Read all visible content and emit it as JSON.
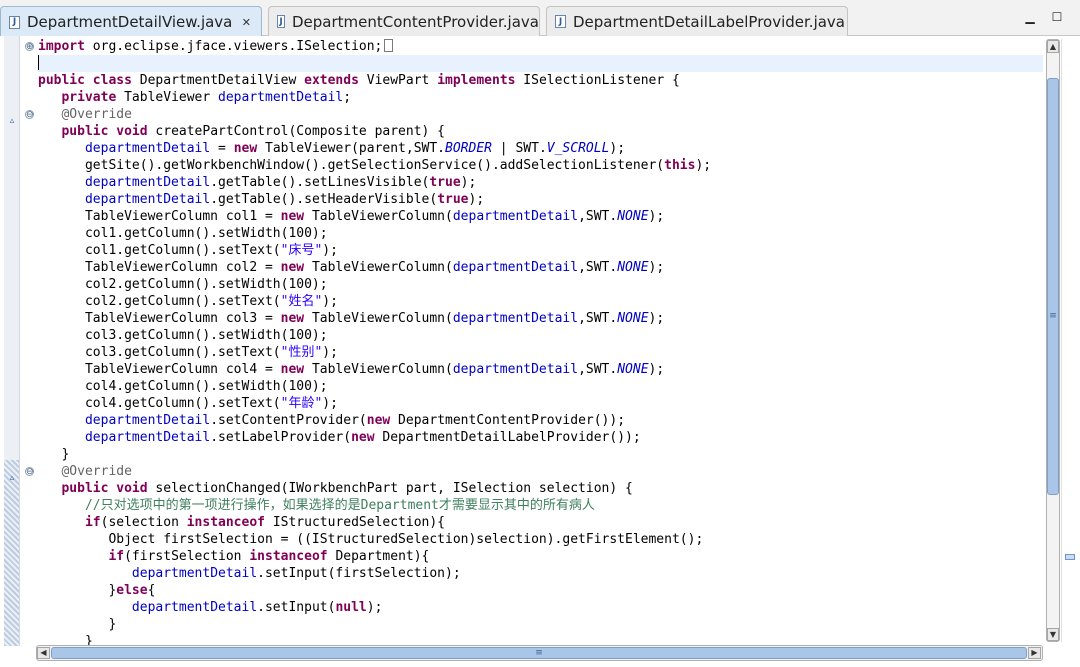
{
  "tabs": [
    {
      "label": "DepartmentDetailView.java",
      "active": true,
      "icon": "java-file-icon",
      "closable": true
    },
    {
      "label": "DepartmentContentProvider.java",
      "active": false,
      "icon": "java-file-icon"
    },
    {
      "label": "DepartmentDetailLabelProvider.java",
      "active": false,
      "icon": "java-file-icon"
    }
  ],
  "window_controls": {
    "minimize": "minimize-icon",
    "maximize": "maximize-icon"
  },
  "editor": {
    "lines": [
      [
        {
          "t": "import",
          "s": "kw"
        },
        {
          "t": " org.eclipse.jface.viewers.ISelection;"
        }
      ],
      [],
      [
        {
          "t": "public",
          "s": "kw"
        },
        {
          "t": " "
        },
        {
          "t": "class",
          "s": "kw"
        },
        {
          "t": " DepartmentDetailView "
        },
        {
          "t": "extends",
          "s": "kw"
        },
        {
          "t": " ViewPart "
        },
        {
          "t": "implements",
          "s": "kw"
        },
        {
          "t": " ISelectionListener {"
        }
      ],
      [
        {
          "t": "   "
        },
        {
          "t": "private",
          "s": "kw"
        },
        {
          "t": " TableViewer "
        },
        {
          "t": "departmentDetail",
          "s": "fld"
        },
        {
          "t": ";"
        }
      ],
      [
        {
          "t": "   "
        },
        {
          "t": "@Override",
          "s": "ann"
        }
      ],
      [
        {
          "t": "   "
        },
        {
          "t": "public",
          "s": "kw"
        },
        {
          "t": " "
        },
        {
          "t": "void",
          "s": "kw"
        },
        {
          "t": " createPartControl(Composite parent) {"
        }
      ],
      [
        {
          "t": "      "
        },
        {
          "t": "departmentDetail",
          "s": "fld"
        },
        {
          "t": " = "
        },
        {
          "t": "new",
          "s": "kw"
        },
        {
          "t": " TableViewer(parent,SWT."
        },
        {
          "t": "BORDER",
          "s": "sfld"
        },
        {
          "t": " | SWT."
        },
        {
          "t": "V_SCROLL",
          "s": "sfld"
        },
        {
          "t": ");"
        }
      ],
      [
        {
          "t": "      getSite().getWorkbenchWindow().getSelectionService().addSelectionListener("
        },
        {
          "t": "this",
          "s": "kw"
        },
        {
          "t": ");"
        }
      ],
      [
        {
          "t": "      "
        },
        {
          "t": "departmentDetail",
          "s": "fld"
        },
        {
          "t": ".getTable().setLinesVisible("
        },
        {
          "t": "true",
          "s": "kw"
        },
        {
          "t": ");"
        }
      ],
      [
        {
          "t": "      "
        },
        {
          "t": "departmentDetail",
          "s": "fld"
        },
        {
          "t": ".getTable().setHeaderVisible("
        },
        {
          "t": "true",
          "s": "kw"
        },
        {
          "t": ");"
        }
      ],
      [
        {
          "t": "      TableViewerColumn col1 = "
        },
        {
          "t": "new",
          "s": "kw"
        },
        {
          "t": " TableViewerColumn("
        },
        {
          "t": "departmentDetail",
          "s": "fld"
        },
        {
          "t": ",SWT."
        },
        {
          "t": "NONE",
          "s": "sfld"
        },
        {
          "t": ");"
        }
      ],
      [
        {
          "t": "      col1.getColumn().setWidth(100);"
        }
      ],
      [
        {
          "t": "      col1.getColumn().setText("
        },
        {
          "t": "\"床号\"",
          "s": "str"
        },
        {
          "t": ");"
        }
      ],
      [
        {
          "t": "      TableViewerColumn col2 = "
        },
        {
          "t": "new",
          "s": "kw"
        },
        {
          "t": " TableViewerColumn("
        },
        {
          "t": "departmentDetail",
          "s": "fld"
        },
        {
          "t": ",SWT."
        },
        {
          "t": "NONE",
          "s": "sfld"
        },
        {
          "t": ");"
        }
      ],
      [
        {
          "t": "      col2.getColumn().setWidth(100);"
        }
      ],
      [
        {
          "t": "      col2.getColumn().setText("
        },
        {
          "t": "\"姓名\"",
          "s": "str"
        },
        {
          "t": ");"
        }
      ],
      [
        {
          "t": "      TableViewerColumn col3 = "
        },
        {
          "t": "new",
          "s": "kw"
        },
        {
          "t": " TableViewerColumn("
        },
        {
          "t": "departmentDetail",
          "s": "fld"
        },
        {
          "t": ",SWT."
        },
        {
          "t": "NONE",
          "s": "sfld"
        },
        {
          "t": ");"
        }
      ],
      [
        {
          "t": "      col3.getColumn().setWidth(100);"
        }
      ],
      [
        {
          "t": "      col3.getColumn().setText("
        },
        {
          "t": "\"性别\"",
          "s": "str"
        },
        {
          "t": ");"
        }
      ],
      [
        {
          "t": "      TableViewerColumn col4 = "
        },
        {
          "t": "new",
          "s": "kw"
        },
        {
          "t": " TableViewerColumn("
        },
        {
          "t": "departmentDetail",
          "s": "fld"
        },
        {
          "t": ",SWT."
        },
        {
          "t": "NONE",
          "s": "sfld"
        },
        {
          "t": ");"
        }
      ],
      [
        {
          "t": "      col4.getColumn().setWidth(100);"
        }
      ],
      [
        {
          "t": "      col4.getColumn().setText("
        },
        {
          "t": "\"年龄\"",
          "s": "str"
        },
        {
          "t": ");"
        }
      ],
      [
        {
          "t": "      "
        },
        {
          "t": "departmentDetail",
          "s": "fld"
        },
        {
          "t": ".setContentProvider("
        },
        {
          "t": "new",
          "s": "kw"
        },
        {
          "t": " DepartmentContentProvider());"
        }
      ],
      [
        {
          "t": "      "
        },
        {
          "t": "departmentDetail",
          "s": "fld"
        },
        {
          "t": ".setLabelProvider("
        },
        {
          "t": "new",
          "s": "kw"
        },
        {
          "t": " DepartmentDetailLabelProvider());"
        }
      ],
      [
        {
          "t": "   }"
        }
      ],
      [
        {
          "t": "   "
        },
        {
          "t": "@Override",
          "s": "ann"
        }
      ],
      [
        {
          "t": "   "
        },
        {
          "t": "public",
          "s": "kw"
        },
        {
          "t": " "
        },
        {
          "t": "void",
          "s": "kw"
        },
        {
          "t": " selectionChanged(IWorkbenchPart part, ISelection selection) {"
        }
      ],
      [
        {
          "t": "      "
        },
        {
          "t": "//只对选项中的第一项进行操作，如果选择的是Department才需要显示其中的所有病人",
          "s": "cmt"
        }
      ],
      [
        {
          "t": "      "
        },
        {
          "t": "if",
          "s": "kw"
        },
        {
          "t": "(selection "
        },
        {
          "t": "instanceof",
          "s": "kw"
        },
        {
          "t": " IStructuredSelection){"
        }
      ],
      [
        {
          "t": "         Object firstSelection = ((IStructuredSelection)selection).getFirstElement();"
        }
      ],
      [
        {
          "t": "         "
        },
        {
          "t": "if",
          "s": "kw"
        },
        {
          "t": "(firstSelection "
        },
        {
          "t": "instanceof",
          "s": "kw"
        },
        {
          "t": " Department){"
        }
      ],
      [
        {
          "t": "            "
        },
        {
          "t": "departmentDetail",
          "s": "fld"
        },
        {
          "t": ".setInput(firstSelection);"
        }
      ],
      [
        {
          "t": "         }"
        },
        {
          "t": "else",
          "s": "kw"
        },
        {
          "t": "{"
        }
      ],
      [
        {
          "t": "            "
        },
        {
          "t": "departmentDetail",
          "s": "fld"
        },
        {
          "t": ".setInput("
        },
        {
          "t": "null",
          "s": "kw"
        },
        {
          "t": ");"
        }
      ],
      [
        {
          "t": "         }"
        }
      ],
      [
        {
          "t": "      }"
        }
      ]
    ],
    "current_line": 1,
    "collapsed_import_line": 0,
    "fold_markers": [
      {
        "line": 0,
        "symbol": "⊕"
      },
      {
        "line": 4,
        "symbol": "⊖"
      },
      {
        "line": 25,
        "symbol": "⊖"
      }
    ],
    "override_markers": [
      5,
      26
    ]
  },
  "scrollbars": {
    "vertical_grip": "≡",
    "horizontal_grip": "≡"
  }
}
